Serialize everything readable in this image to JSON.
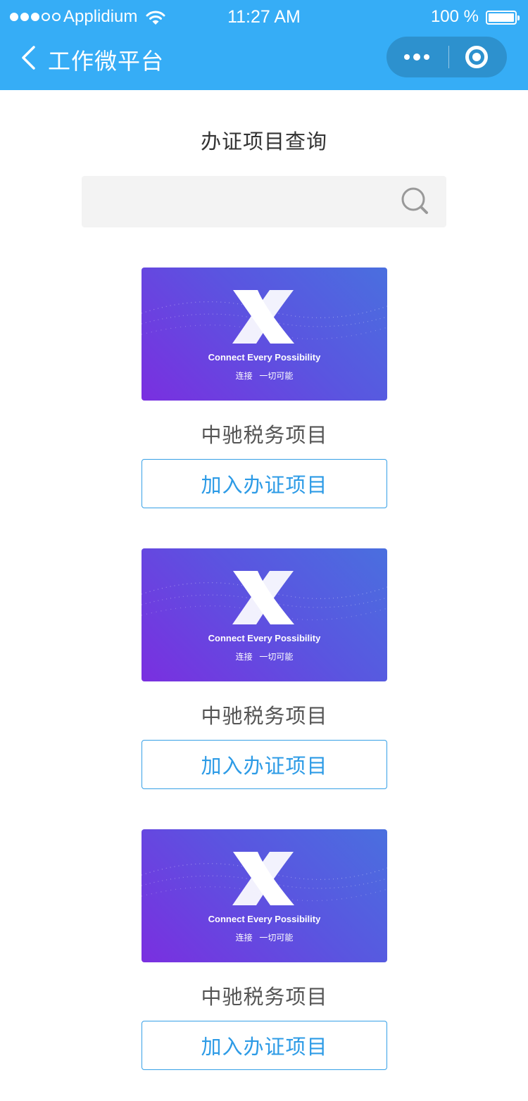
{
  "status_bar": {
    "carrier": "Applidium",
    "time": "11:27 AM",
    "battery": "100 %",
    "signal_dots_filled": 3,
    "signal_dots_total": 5
  },
  "nav": {
    "title": "工作微平台",
    "icons": [
      "back-chevron-icon",
      "more-dots-icon",
      "close-target-icon"
    ]
  },
  "page": {
    "title": "办证项目查询",
    "search": {
      "value": "",
      "icon": "search-icon"
    }
  },
  "items": [
    {
      "banner_en": "Connect Every Possibility",
      "banner_cn": "连接 一切可能",
      "name": "中驰税务项目",
      "button": "加入办证项目"
    },
    {
      "banner_en": "Connect Every Possibility",
      "banner_cn": "连接 一切可能",
      "name": "中驰税务项目",
      "button": "加入办证项目"
    },
    {
      "banner_en": "Connect Every Possibility",
      "banner_cn": "连接 一切可能",
      "name": "中驰税务项目",
      "button": "加入办证项目"
    }
  ],
  "colors": {
    "header_bg": "#36adf6",
    "accent": "#2d9be6",
    "banner_gradient": [
      "#4a6fdf",
      "#7a2fe0"
    ]
  }
}
